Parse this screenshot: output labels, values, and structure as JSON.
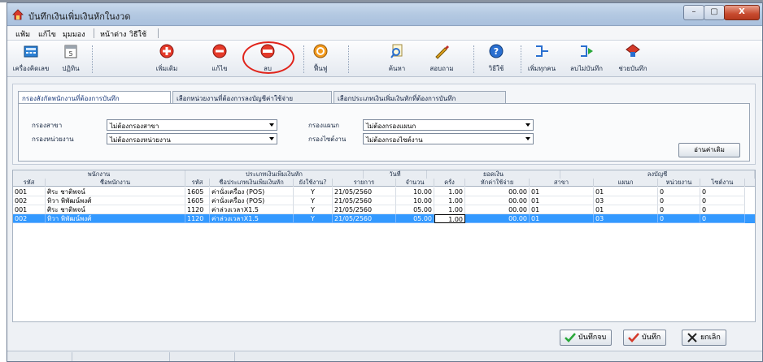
{
  "window": {
    "title": "บันทึกเงินเพิ่มเงินหักในงวด",
    "controls": [
      "–",
      "▢",
      "X"
    ]
  },
  "menu": [
    "แฟ้ม",
    "แก้ไข",
    "มุมมอง",
    "หน้าต่าง",
    "วิธีใช้"
  ],
  "toolbar": {
    "calculator": "เครื่องคิดเลข",
    "calendar": "ปฏิทิน",
    "add": "เพิ่มเติม",
    "edit": "แก้ไข",
    "delete": "ลบ",
    "restore": "ฟื้นฟู",
    "search": "ค้นหา",
    "inquiry": "สอบถาม",
    "help": "วิธีใช้",
    "add_all": "เพิ่มทุกคน",
    "delete_unsaved": "ลบไม่บันทึก",
    "help_save": "ช่วยบันทึก"
  },
  "tabs": [
    "กรองสังกัดพนักงานที่ต้องการบันทึก",
    "เลือกหน่วยงานที่ต้องการลงบัญชีค่าใช้จ่าย",
    "เลือกประเภทเงินเพิ่มเงินหักที่ต้องการบันทึก"
  ],
  "filters": {
    "branch_label": "กรองสาขา",
    "branch_value": "ไม่ต้องกรองสาขา",
    "unit_label": "กรองหน่วยงาน",
    "unit_value": "ไม่ต้องกรองหน่วยงาน",
    "dept_label": "กรองแผนก",
    "dept_value": "ไม่ต้องกรองแผนก",
    "section_label": "กรองไซต์งาน",
    "section_value": "ไม่ต้องกรองไซต์งาน",
    "read_button": "อ่านค่าเดิม"
  },
  "grid": {
    "groups": [
      "พนักงาน",
      "ประเภทเงินเพิ่มเงินหัก",
      "วันที่",
      "ยอดเงิน",
      "ลงบัญชี"
    ],
    "columns": [
      "รหัส",
      "ชื่อพนักงาน",
      "รหัส",
      "ชื่อประเภทเงินเพิ่มเงินหัก",
      "ยังใช้งาน?",
      "รายการ",
      "จำนวน",
      "ครั้ง",
      "หักค่าใช้จ่าย",
      "สาขา",
      "แผนก",
      "หน่วยงาน",
      "ไซต์งาน"
    ],
    "rows": [
      [
        "001",
        "ศิระ  ชาติพจน์",
        "1605",
        "ค่านั่งเครื่อง (POS)",
        "Y",
        "21/05/2560",
        "10.00",
        "1.00",
        "00.00",
        "01",
        "01",
        "0",
        "0"
      ],
      [
        "002",
        "ทิวา  พิพัฒน์พงศ์",
        "1605",
        "ค่านั่งเครื่อง (POS)",
        "Y",
        "21/05/2560",
        "10.00",
        "1.00",
        "00.00",
        "01",
        "03",
        "0",
        "0"
      ],
      [
        "001",
        "ศิระ  ชาติพจน์",
        "1120",
        "ค่าล่วงเวลาX1.5",
        "Y",
        "21/05/2560",
        "05.00",
        "1.00",
        "00.00",
        "01",
        "01",
        "0",
        "0"
      ],
      [
        "002",
        "ทิวา  พิพัฒน์พงศ์",
        "1120",
        "ค่าล่วงเวลาX1.5",
        "Y",
        "21/05/2560",
        "05.00",
        "1.00",
        "00.00",
        "01",
        "03",
        "0",
        "0"
      ]
    ],
    "selected_row": 3
  },
  "buttons": {
    "save_close": "บันทึกจบ",
    "save": "บันทึก",
    "cancel": "ยกเลิก"
  },
  "colors": {
    "selection": "#3399ff",
    "highlight_circle": "#e0241b"
  }
}
